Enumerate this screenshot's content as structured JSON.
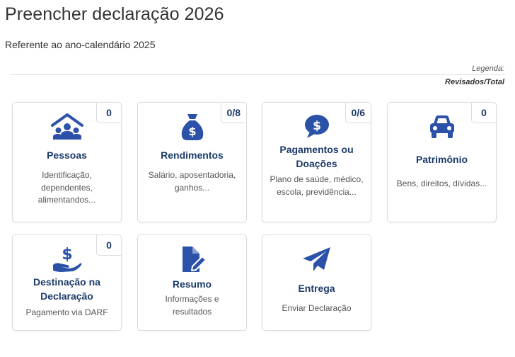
{
  "page": {
    "title": "Preencher declaração 2026",
    "subtitle": "Referente ao ano-calendário 2025"
  },
  "legend": {
    "label": "Legenda:",
    "value": "Revisados/Total"
  },
  "theme": {
    "accent": "#2b52a8",
    "title_color": "#1c3a68"
  },
  "cards": [
    {
      "title": "Pessoas",
      "counter": "0",
      "description": "Identificação, dependentes, alimentandos...",
      "icon": "people-house-icon"
    },
    {
      "title": "Rendimentos",
      "counter": "0/8",
      "description": "Salário, aposentadoria, ganhos...",
      "icon": "money-bag-icon"
    },
    {
      "title": "Pagamentos ou Doações",
      "counter": "0/6",
      "description": "Plano de saúde, médico, escola, previdência...",
      "icon": "payment-bubble-icon"
    },
    {
      "title": "Patrimônio",
      "counter": "0",
      "description": "Bens, direitos, dívidas...",
      "icon": "car-icon"
    },
    {
      "title": "Destinação na Declaração",
      "counter": "0",
      "description": "Pagamento via DARF",
      "icon": "hand-money-icon"
    },
    {
      "title": "Resumo",
      "counter": "",
      "description": "Informações e resultados",
      "icon": "document-edit-icon"
    },
    {
      "title": "Entrega",
      "counter": "",
      "description": "Enviar Declaração",
      "icon": "paper-plane-icon"
    }
  ]
}
